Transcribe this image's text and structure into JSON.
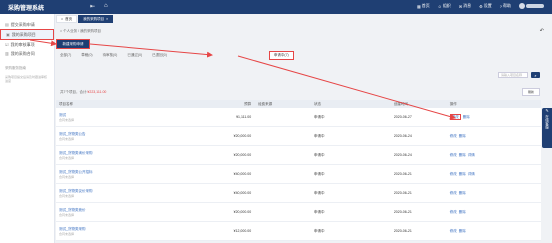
{
  "app_title": "采购管理系统",
  "topbar": {
    "items": [
      {
        "icon": "grid-icon",
        "label": "首页"
      },
      {
        "icon": "user-icon",
        "label": "组织"
      },
      {
        "icon": "message-icon",
        "label": "消息"
      },
      {
        "icon": "gear-icon",
        "label": "设置"
      },
      {
        "icon": "help-icon",
        "label": "帮助"
      }
    ]
  },
  "sidebar": {
    "items": [
      {
        "label": "提交采购申请"
      },
      {
        "label": "我的采购项目"
      },
      {
        "label": "我的审核事项"
      },
      {
        "label": "我的采购合同"
      }
    ],
    "group_label": "采购服务指南",
    "note": "采购项目提交后请及时跟进审核进度"
  },
  "tabs": [
    {
      "label": "首页"
    },
    {
      "label": "我的采购项目"
    }
  ],
  "breadcrumb": "个人业务 / 我的采购项目",
  "new_button": "新建采购申请",
  "status_tabs": [
    {
      "label": "全部(7)"
    },
    {
      "label": "草稿(0)"
    },
    {
      "label": "待审核(0)"
    },
    {
      "label": "已通过(0)"
    },
    {
      "label": "已退回(0)"
    },
    {
      "label": "申请中(7)"
    }
  ],
  "search": {
    "placeholder": "请输入项目名称",
    "button": "Q"
  },
  "summary": {
    "prefix": "共7个项目，合计:",
    "amount": "¥223,111.00"
  },
  "refresh_label": "刷新",
  "table": {
    "headers": [
      "项目名称",
      "预算",
      "经费来源",
      "状态",
      "创建时间",
      "操作"
    ],
    "rows": [
      {
        "name": "测试",
        "contract": "合同未选择",
        "amount": "¥1,111.00",
        "status": "申请中",
        "date": "2020-06-27",
        "ops": [
          "修改",
          "删除"
        ]
      },
      {
        "name": "测试_货物类公告",
        "contract": "合同未选择",
        "amount": "¥20,000.00",
        "status": "申请中",
        "date": "2020-06-24",
        "ops": [
          "修改",
          "删除"
        ]
      },
      {
        "name": "测试_货物类询价采购",
        "contract": "合同未选择",
        "amount": "¥20,000.00",
        "status": "申请中",
        "date": "2020-06-24",
        "ops": [
          "修改",
          "删除",
          "详情"
        ]
      },
      {
        "name": "测试_货物类公开招标",
        "contract": "合同未选择",
        "amount": "¥40,000.00",
        "status": "申请中",
        "date": "2020-06-21",
        "ops": [
          "修改",
          "删除",
          "详情"
        ]
      },
      {
        "name": "测试_货物类议价采购",
        "contract": "合同未选择",
        "amount": "¥40,000.00",
        "status": "申请中",
        "date": "2020-06-21",
        "ops": [
          "修改",
          "删除"
        ]
      },
      {
        "name": "测试_货物类竞价",
        "contract": "合同未选择",
        "amount": "¥20,000.00",
        "status": "申请中",
        "date": "2020-06-21",
        "ops": [
          "修改",
          "删除"
        ]
      },
      {
        "name": "测试_货物类采购",
        "contract": "合同未选择",
        "amount": "¥12,000.00",
        "status": "申请中",
        "date": "2020-06-21",
        "ops": [
          "修改",
          "删除"
        ]
      }
    ]
  },
  "float_help": {
    "icon": "chat-icon",
    "label": "在线客服"
  },
  "colors": {
    "brand": "#1f3f73",
    "highlight": "#e64646",
    "link": "#3a6fc0"
  }
}
